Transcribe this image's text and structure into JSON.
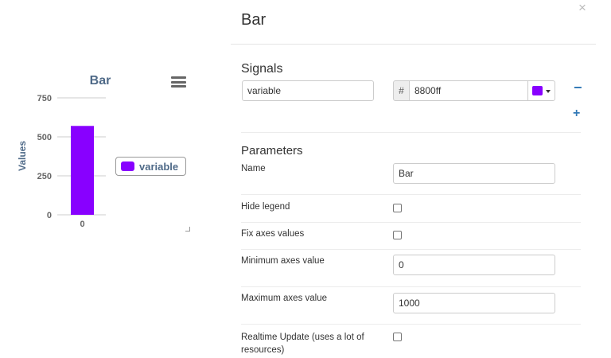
{
  "chart": {
    "legend_label": "variable",
    "accent": "#8800ff"
  },
  "chart_data": {
    "type": "bar",
    "title": "Bar",
    "categories": [
      "0"
    ],
    "series": [
      {
        "name": "variable",
        "values": [
          570
        ]
      }
    ],
    "ylabel": "Values",
    "xlabel": "",
    "ylim": [
      0,
      750
    ],
    "yticks": [
      "0",
      "250",
      "500",
      "750"
    ],
    "grid": true,
    "legend_position": "right"
  },
  "modal": {
    "title": "Bar",
    "close_icon": "×",
    "signals_title": "Signals",
    "signal": {
      "name_value": "variable",
      "hash_label": "#",
      "color_value": "8800ff",
      "color": "#8800ff"
    },
    "remove_label": "−",
    "add_label": "+",
    "parameters_title": "Parameters",
    "fields": {
      "name_label": "Name",
      "name_value": "Bar",
      "hide_legend_label": "Hide legend",
      "fix_axes_label": "Fix axes values",
      "min_axes_label": "Minimum axes value",
      "min_axes_value": "0",
      "max_axes_label": "Maximum axes value",
      "max_axes_value": "1000",
      "realtime_label_line1": "Realtime Update (uses a lot of",
      "realtime_label_line2": "resources)"
    }
  }
}
